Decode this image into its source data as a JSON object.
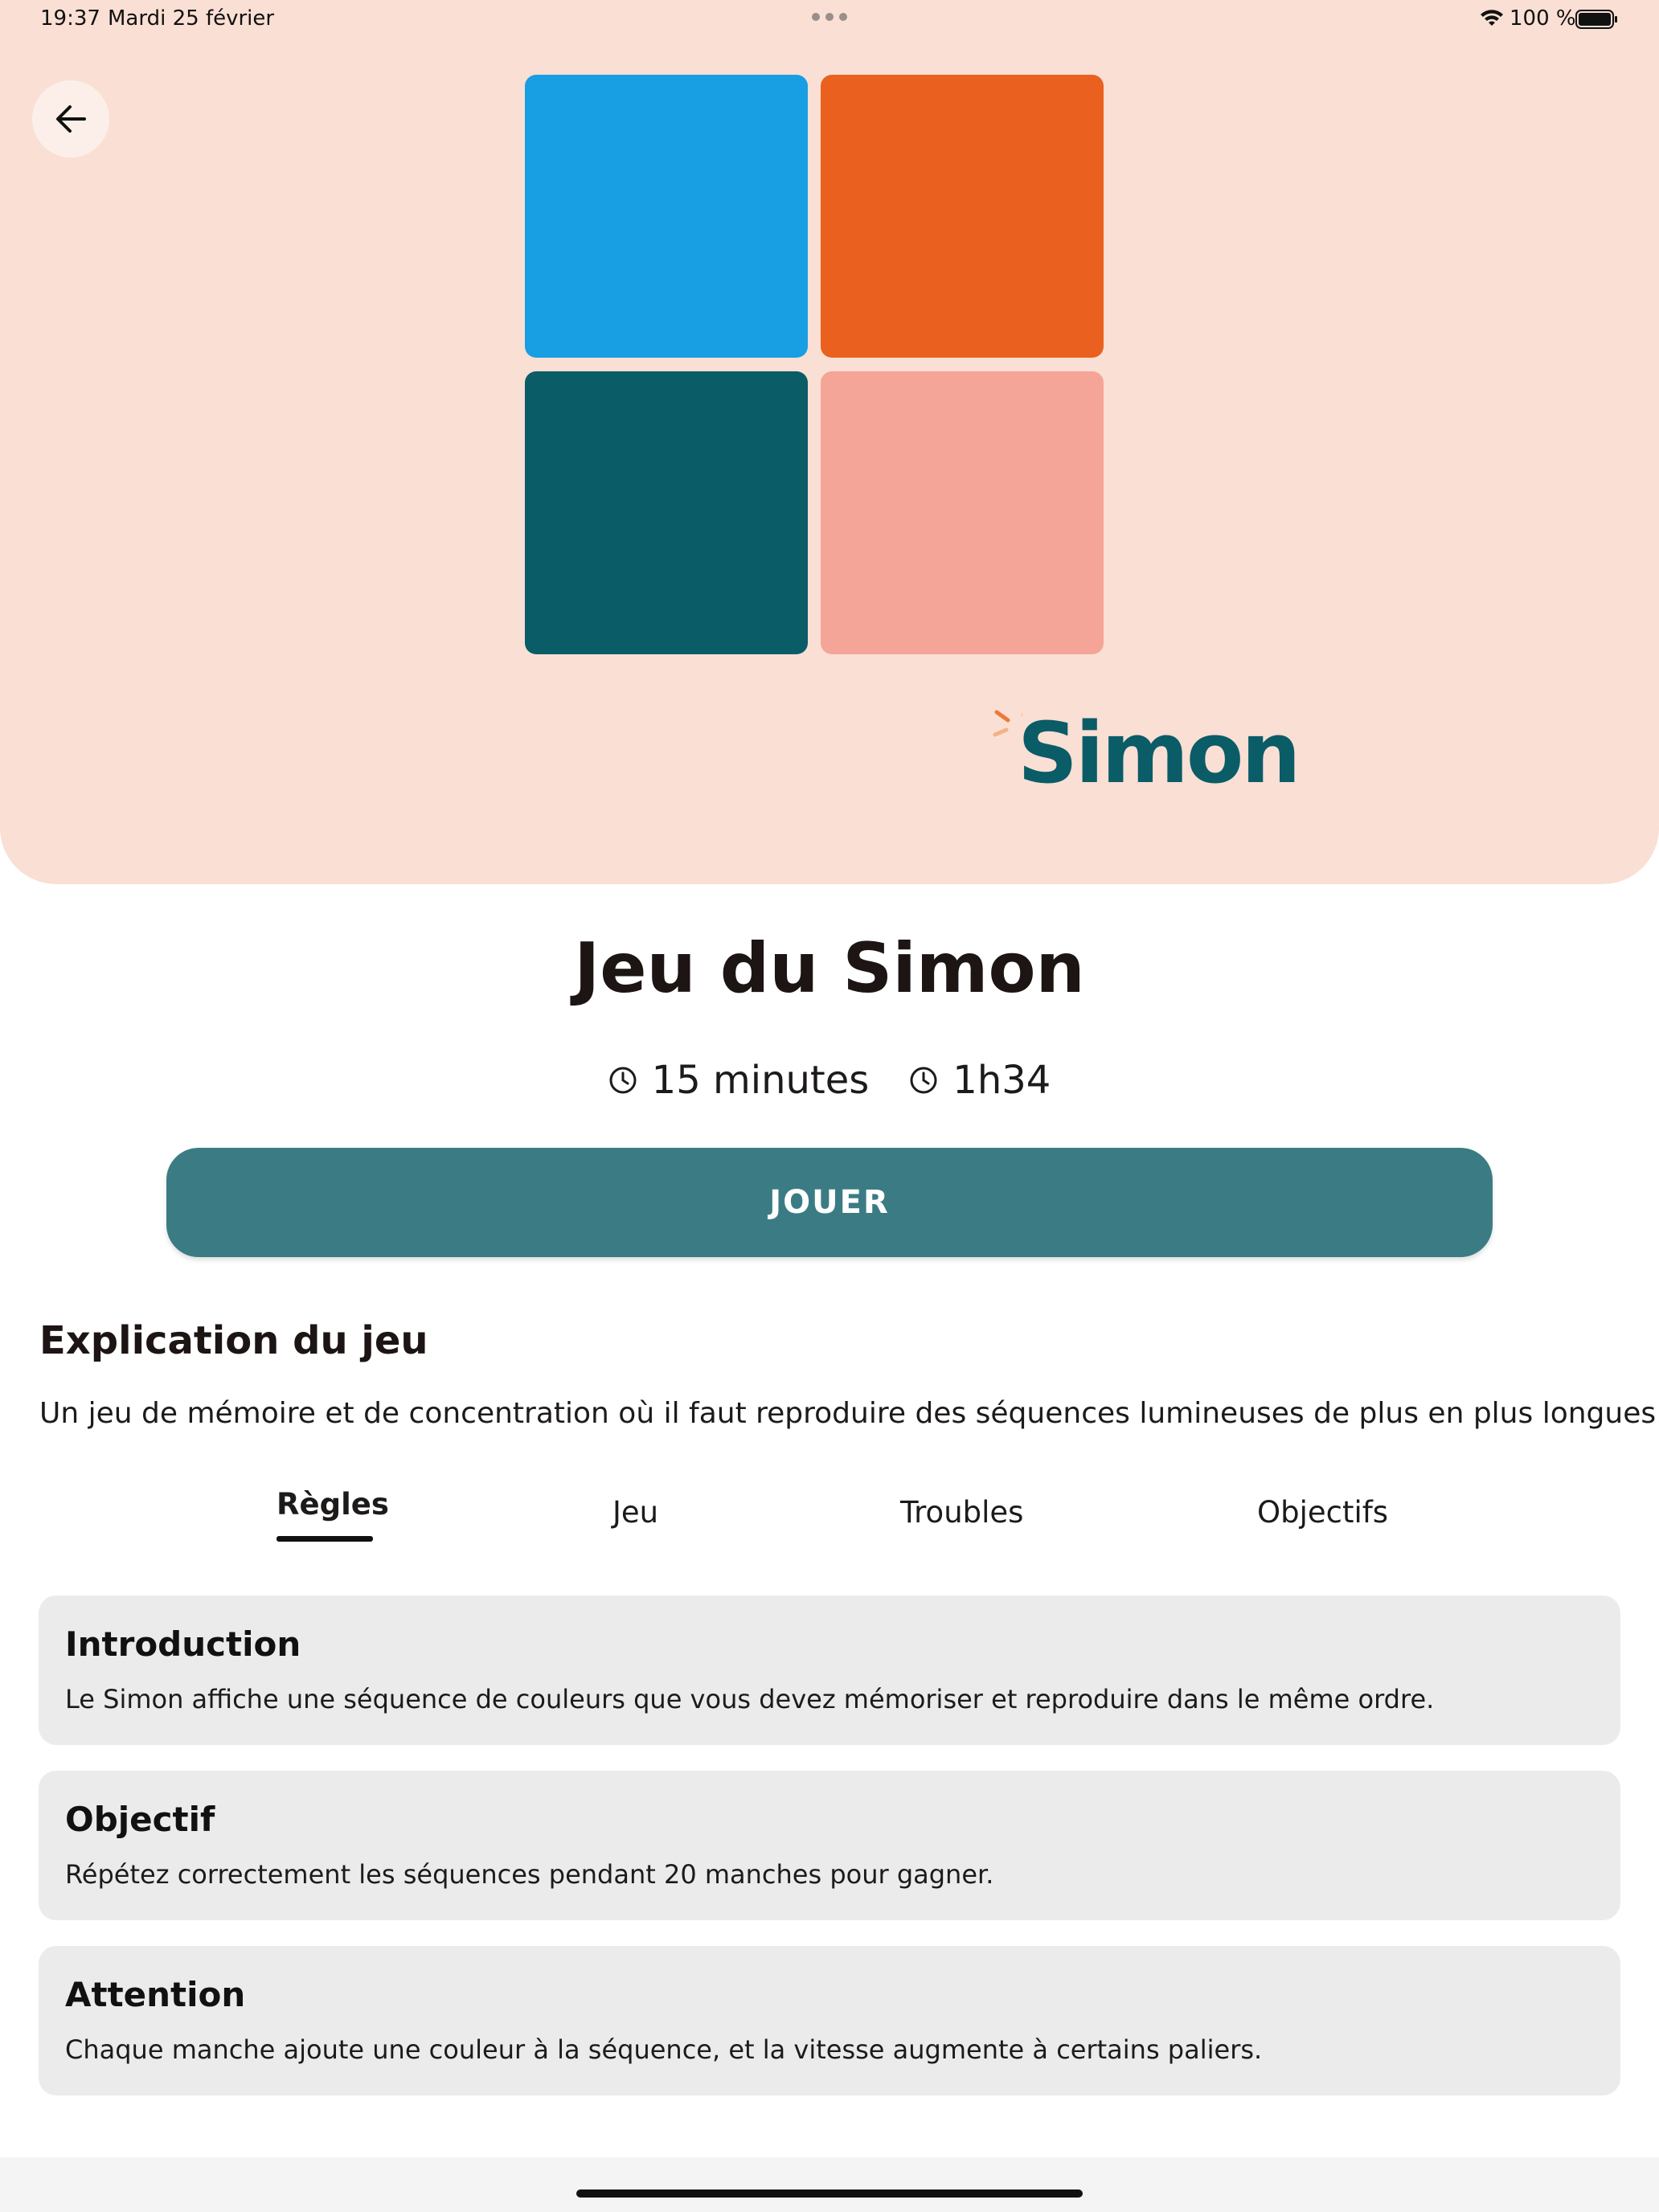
{
  "status_bar": {
    "time": "19:37",
    "date": "Mardi 25 février",
    "battery": "100 %"
  },
  "hero": {
    "background_color": "#fadfd4",
    "tiles": [
      {
        "color": "#179ee3"
      },
      {
        "color": "#ea601e"
      },
      {
        "color": "#0a5c67"
      },
      {
        "color": "#f5a498"
      }
    ],
    "logo_text": "Simon"
  },
  "game": {
    "title": "Jeu du Simon",
    "duration": "15 minutes",
    "time_played": "1h34",
    "play_label": "JOUER"
  },
  "explanation": {
    "heading": "Explication du jeu",
    "description": "Un jeu de mémoire et de concentration où il faut reproduire des séquences lumineuses de plus en plus longues."
  },
  "tabs": {
    "items": [
      {
        "label": "Règles",
        "selected": true
      },
      {
        "label": "Jeu",
        "selected": false
      },
      {
        "label": "Troubles",
        "selected": false
      },
      {
        "label": "Objectifs",
        "selected": false
      }
    ]
  },
  "rules": [
    {
      "title": "Introduction",
      "text": "Le Simon affiche une séquence de couleurs que vous devez mémoriser et reproduire dans le même ordre."
    },
    {
      "title": "Objectif",
      "text": "Répétez correctement les séquences pendant 20 manches pour gagner."
    },
    {
      "title": "Attention",
      "text": "Chaque manche ajoute une couleur à la séquence, et la vitesse augmente à certains paliers."
    }
  ],
  "icons": {
    "back": "arrow-left-icon",
    "duration": "clock-icon",
    "time_played": "clock-icon",
    "wifi": "wifi-icon",
    "battery": "battery-icon"
  },
  "colors": {
    "accent": "#3b7c84",
    "card_background": "#ebebeb"
  }
}
